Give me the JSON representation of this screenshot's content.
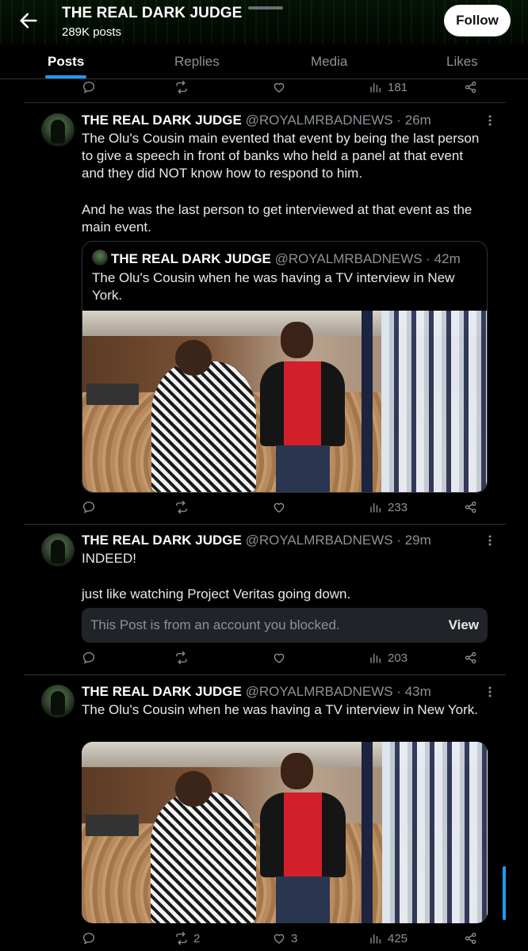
{
  "header": {
    "title": "THE REAL DARK JUDGE",
    "subtitle": "289K posts",
    "follow_label": "Follow"
  },
  "tabs": [
    {
      "label": "Posts",
      "active": true
    },
    {
      "label": "Replies",
      "active": false
    },
    {
      "label": "Media",
      "active": false
    },
    {
      "label": "Likes",
      "active": false
    }
  ],
  "top_actions": {
    "views": "181"
  },
  "posts": [
    {
      "name": "THE REAL DARK JUDGE",
      "meta": "@ROYALMRBADNEWS · 26m",
      "text1": "The Olu's Cousin main evented that event by being the last person to give a speech in front of banks who held a panel at that event and they did NOT know how to respond to him.",
      "text2": "And he was the last person to get interviewed at that event as the main event.",
      "quote": {
        "name": "THE REAL DARK JUDGE",
        "meta": "@ROYALMRBADNEWS · 42m",
        "text": "The Olu's Cousin when he was having a TV interview in New York."
      },
      "views": "233"
    },
    {
      "name": "THE REAL DARK JUDGE",
      "meta": "@ROYALMRBADNEWS · 29m",
      "text1": "INDEED!",
      "text2": "just like watching Project Veritas going down.",
      "blocked_text": "This Post is from an account you blocked.",
      "blocked_action": "View",
      "views": "203"
    },
    {
      "name": "THE REAL DARK JUDGE",
      "meta": "@ROYALMRBADNEWS · 43m",
      "text1": "The Olu's Cousin when he was having a TV interview in New York.",
      "reposts": "2",
      "likes": "3",
      "views": "425"
    }
  ],
  "colors": {
    "accent": "#1d9bf0",
    "background": "#000000",
    "muted": "#8b9298",
    "divider": "#2f3336"
  }
}
